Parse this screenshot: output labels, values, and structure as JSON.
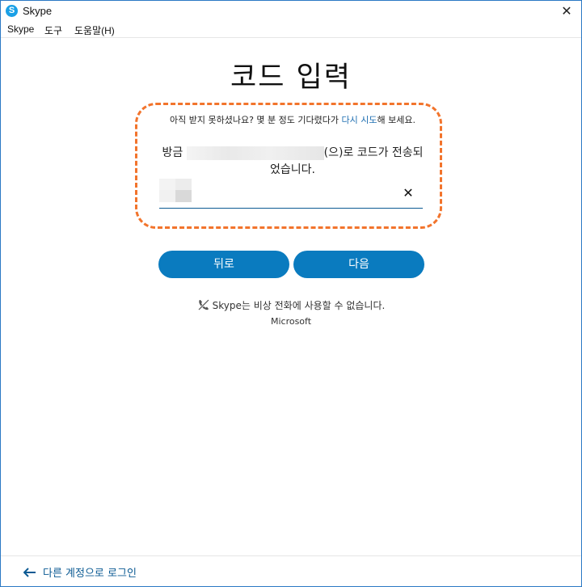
{
  "window": {
    "title": "Skype",
    "close_glyph": "✕",
    "app_icon_letter": "S"
  },
  "menu": {
    "items": [
      "Skype",
      "도구",
      "도움말(H)"
    ]
  },
  "main": {
    "title": "코드 입력",
    "hint_prefix": "아직 받지 못하셨나요? 몇 분 정도 기다렸다가 ",
    "hint_link": "다시 시도",
    "hint_suffix": "해 보세요.",
    "sent_prefix": "방금 ",
    "sent_suffix": "(으)로 코드가 전송되었습니다.",
    "clear_glyph": "✕",
    "back_button": "뒤로",
    "next_button": "다음",
    "emergency_notice": "Skype는 비상 전화에 사용할 수 없습니다.",
    "vendor": "Microsoft"
  },
  "footer": {
    "other_account_link": "다른 계정으로 로그인"
  },
  "colors": {
    "accent": "#0a7bbf",
    "highlight": "#f2742c",
    "link": "#1f6fb2"
  },
  "icons": {
    "app": "skype-logo-icon",
    "close": "close-icon",
    "clear": "clear-input-icon",
    "no_call": "no-emergency-call-icon",
    "back": "arrow-left-icon"
  }
}
